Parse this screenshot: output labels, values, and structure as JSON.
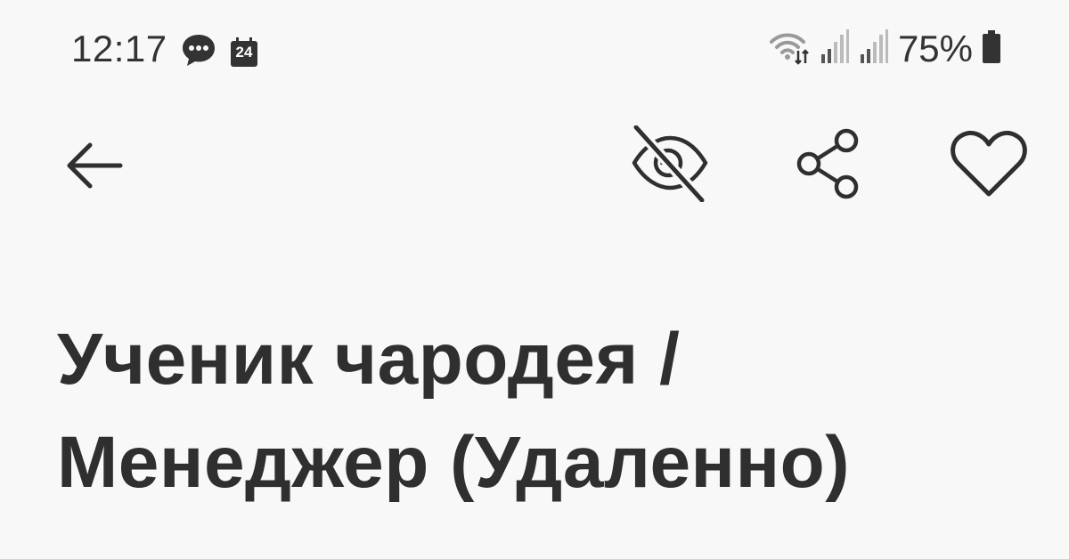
{
  "status_bar": {
    "time": "12:17",
    "notification_icons": [
      "chat-bubble-icon",
      "calendar-icon"
    ],
    "calendar_day": "24",
    "system_icons": [
      "wifi-data-icon",
      "signal-icon",
      "signal-icon",
      "battery-icon"
    ],
    "battery_percent": "75%"
  },
  "app_bar": {
    "actions": [
      "back-arrow-icon",
      "eye-off-icon",
      "share-icon",
      "heart-icon"
    ]
  },
  "vacancy": {
    "title": "Ученик чародея / Менеджер (Удаленно)"
  },
  "colors": {
    "background": "#f8f8f8",
    "text": "#2f2f2f",
    "icons": "#2f2f2f"
  }
}
